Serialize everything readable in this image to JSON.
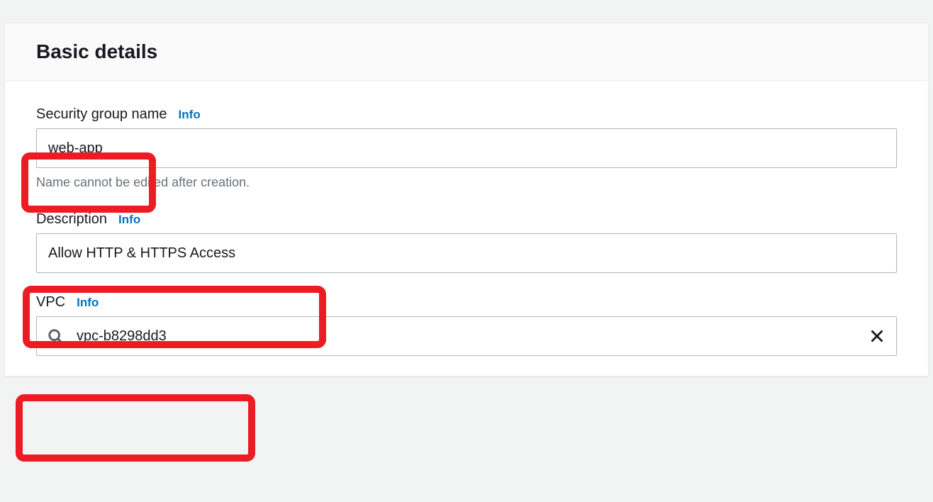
{
  "panel": {
    "title": "Basic details"
  },
  "fields": {
    "securityGroupName": {
      "label": "Security group name",
      "info": "Info",
      "value": "web-app",
      "helper": "Name cannot be edited after creation."
    },
    "description": {
      "label": "Description",
      "info": "Info",
      "value": "Allow HTTP & HTTPS Access"
    },
    "vpc": {
      "label": "VPC",
      "info": "Info",
      "value": "vpc-b8298dd3"
    }
  }
}
